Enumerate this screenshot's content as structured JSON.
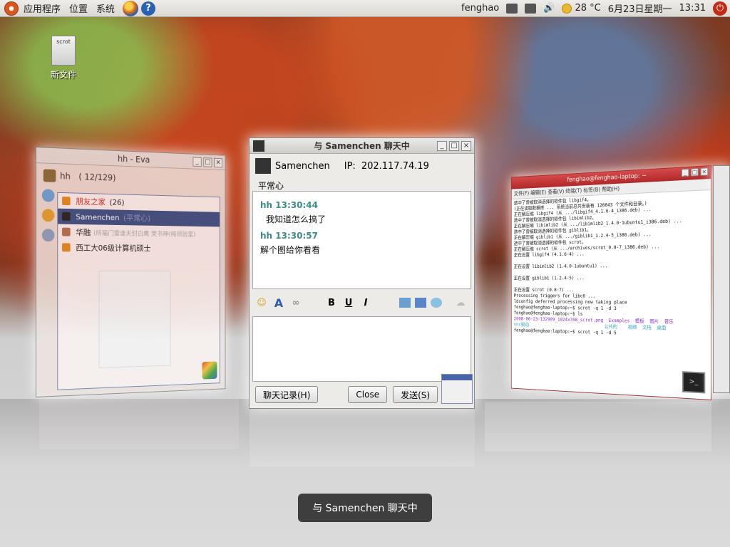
{
  "panel": {
    "menus": [
      "应用程序",
      "位置",
      "系统"
    ],
    "username": "fenghao",
    "temperature": "28 °C",
    "date": "6月23日星期一",
    "time": "13:31"
  },
  "desktop": {
    "icon_label": "新文件",
    "icon_file_text": "scrot"
  },
  "buddy_window": {
    "title": "hh - Eva",
    "nickname": "hh",
    "count": "( 12/129)",
    "rows": [
      {
        "name": "朋友之家",
        "extra": "(26)"
      },
      {
        "name": "Samenchen",
        "extra": "(平常心)"
      },
      {
        "name": "华融",
        "extra": "(所福门雷逢天封白鹰 哭书神(纯领验室)"
      },
      {
        "name": "西工大06级计算机硕士",
        "extra": ""
      }
    ]
  },
  "chat_window": {
    "title": "与 Samenchen 聊天中",
    "contact": "Samenchen",
    "ip_label": "IP:",
    "ip": "202.117.74.19",
    "signature": "平常心",
    "messages": [
      {
        "time": "hh 13:30:44",
        "text": "我知道怎么搞了"
      },
      {
        "time": "hh 13:30:57",
        "text": "解个图给你看看"
      }
    ],
    "history_button": "聊天记录(H)",
    "close_button": "Close",
    "send_button": "发送(S)"
  },
  "terminal_window": {
    "title": "fenghao@fenghao-laptop: ~",
    "menu": "文件(F)  编辑(E)  查看(V)  终端(T)  标签(B)  帮助(H)",
    "lines": [
      "选中了曾被取消选择的软件包 libgif4。",
      "(正在读取数据库 ... 系统当前总共安装有 126843 个文件和目录。)",
      "正在解压缩 libgif4 (从 .../libgif4_4.1.6-4_i386.deb) ...",
      "选中了曾被取消选择的软件包 libimlib2。",
      "正在解压缩 libimlib2 (从 .../libimlib2_1.4.0-1ubuntu1_i386.deb) ...",
      "选中了曾被取消选择的软件包 giblib1。",
      "正在解压缩 giblib1 (从 .../giblib1_1.2.4-5_i386.deb) ...",
      "选中了曾被取消选择的软件包 scrot。",
      "正在解压缩 scrot (从 .../archives/scrot_0.8-7_i386.deb) ...",
      "正在设置 libgif4 (4.1.6-4) ...",
      "",
      "正在设置 libimlib2 (1.4.0-1ubuntu1) ...",
      "",
      "正在设置 giblib1 (1.2.4-5) ...",
      "",
      "正在设置 scrot (0.8-7) ...",
      "Processing triggers for libc6 ...",
      "ldconfig deferred processing now taking place",
      "fenghao@fenghao-laptop:~$ scrot -q 1 -d 3",
      "fenghao@fenghao-laptop:~$ ls",
      "2008-06-23-132909_1024x768_scrot.png  Examples  模板  图片  音乐",
      "vnc驱动                              公共的    视频  文档  桌面",
      "fenghao@fenghao-laptop:~$ scrot -q 1 -d 5"
    ]
  },
  "tooltip": "与 Samenchen 聊天中"
}
